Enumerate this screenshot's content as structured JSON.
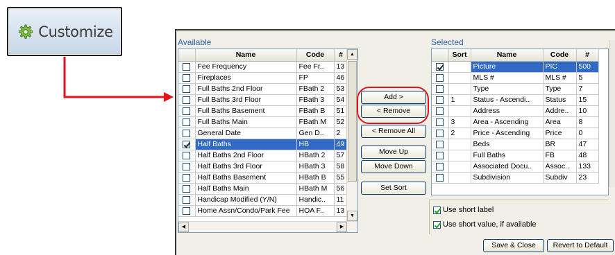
{
  "customize_button": {
    "label": "Customize",
    "icon": "gear-icon"
  },
  "available": {
    "label": "Available",
    "columns": [
      "",
      "Name",
      "Code",
      "#"
    ],
    "rows": [
      {
        "checked": false,
        "name": "Fee Frequency",
        "code": "Fee Fr..",
        "num": "13",
        "selected": false
      },
      {
        "checked": false,
        "name": "Fireplaces",
        "code": "FP",
        "num": "46",
        "selected": false
      },
      {
        "checked": false,
        "name": "Full Baths 2nd Floor",
        "code": "FBath 2",
        "num": "53",
        "selected": false
      },
      {
        "checked": false,
        "name": "Full Baths 3rd Floor",
        "code": "FBath 3",
        "num": "54",
        "selected": false
      },
      {
        "checked": false,
        "name": "Full Baths Basement",
        "code": "FBath B",
        "num": "51",
        "selected": false
      },
      {
        "checked": false,
        "name": "Full Baths Main",
        "code": "FBath M",
        "num": "52",
        "selected": false
      },
      {
        "checked": false,
        "name": "General Date",
        "code": "Gen D..",
        "num": "2",
        "selected": false
      },
      {
        "checked": true,
        "name": "Half Baths",
        "code": "HB",
        "num": "49",
        "selected": true
      },
      {
        "checked": false,
        "name": "Half Baths 2nd Floor",
        "code": "HBath 2",
        "num": "57",
        "selected": false
      },
      {
        "checked": false,
        "name": "Half Baths 3rd Floor",
        "code": "HBath 3",
        "num": "58",
        "selected": false
      },
      {
        "checked": false,
        "name": "Half Baths Basement",
        "code": "HBath B",
        "num": "55",
        "selected": false
      },
      {
        "checked": false,
        "name": "Half Baths Main",
        "code": "HBath M",
        "num": "56",
        "selected": false
      },
      {
        "checked": false,
        "name": "Handicap Modified (Y/N)",
        "code": "Handic..",
        "num": "11",
        "selected": false
      },
      {
        "checked": false,
        "name": "Home Assn/Condo/Park Fee",
        "code": "HOA F..",
        "num": "13",
        "selected": false
      }
    ]
  },
  "buttons": {
    "add": "Add >",
    "remove": "< Remove",
    "remove_all": "< Remove All",
    "move_up": "Move Up",
    "move_down": "Move Down",
    "set_sort": "Set Sort"
  },
  "selected": {
    "label": "Selected",
    "columns": [
      "",
      "Sort",
      "Name",
      "Code",
      "#"
    ],
    "rows": [
      {
        "checked": true,
        "sort": "",
        "name": "Picture",
        "code": "PIC",
        "num": "500",
        "selected": true
      },
      {
        "checked": false,
        "sort": "",
        "name": "MLS #",
        "code": "MLS #",
        "num": "5",
        "selected": false
      },
      {
        "checked": false,
        "sort": "",
        "name": "Type",
        "code": "Type",
        "num": "7",
        "selected": false
      },
      {
        "checked": false,
        "sort": "1",
        "name": "Status - Ascendi..",
        "code": "Status",
        "num": "15",
        "selected": false
      },
      {
        "checked": false,
        "sort": "",
        "name": "Address",
        "code": "Addre..",
        "num": "10",
        "selected": false
      },
      {
        "checked": false,
        "sort": "3",
        "name": "Area - Ascending",
        "code": "Area",
        "num": "8",
        "selected": false
      },
      {
        "checked": false,
        "sort": "2",
        "name": "Price - Ascending",
        "code": "Price",
        "num": "0",
        "selected": false
      },
      {
        "checked": false,
        "sort": "",
        "name": "Beds",
        "code": "BR",
        "num": "47",
        "selected": false
      },
      {
        "checked": false,
        "sort": "",
        "name": "Full Baths",
        "code": "FB",
        "num": "48",
        "selected": false
      },
      {
        "checked": false,
        "sort": "",
        "name": "Associated Docu..",
        "code": "Assoc..",
        "num": "133",
        "selected": false
      },
      {
        "checked": false,
        "sort": "",
        "name": "Subdivision",
        "code": "Subdiv",
        "num": "23",
        "selected": false
      }
    ]
  },
  "options": {
    "short_label": {
      "label": "Use short label",
      "checked": true
    },
    "short_value": {
      "label": "Use short value, if available",
      "checked": true
    }
  },
  "footer": {
    "save_close": "Save & Close",
    "revert": "Revert to Default"
  },
  "colors": {
    "accent": "#316ac5",
    "highlight_ring": "#e0141a",
    "group_label": "#2d5db5"
  }
}
